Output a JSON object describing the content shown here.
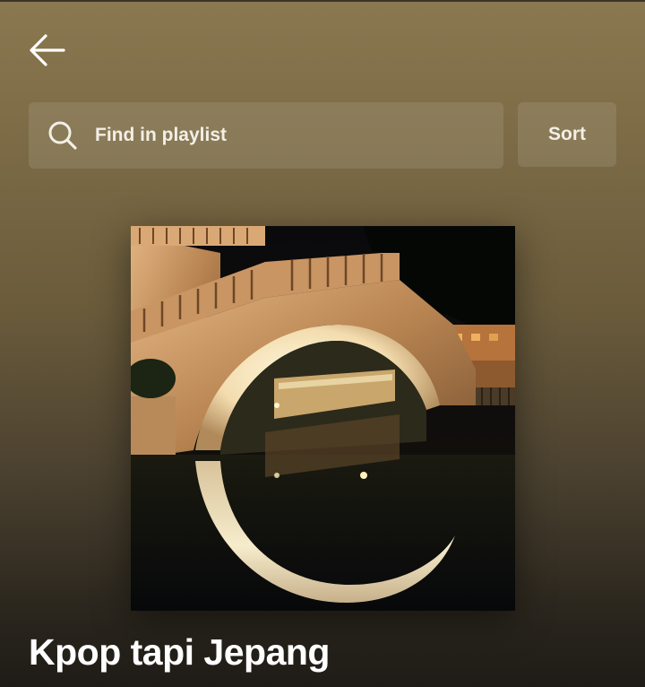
{
  "header": {
    "back_icon": "arrow-left-icon"
  },
  "search": {
    "icon": "search-icon",
    "placeholder": "Find in playlist"
  },
  "sort": {
    "label": "Sort"
  },
  "playlist": {
    "title": "Kpop tapi Jepang",
    "cover_description_icon": "playlist-cover-image"
  },
  "colors": {
    "background_top": "#8a7850",
    "background_bottom": "#1e1c17",
    "text": "#ffffff"
  }
}
